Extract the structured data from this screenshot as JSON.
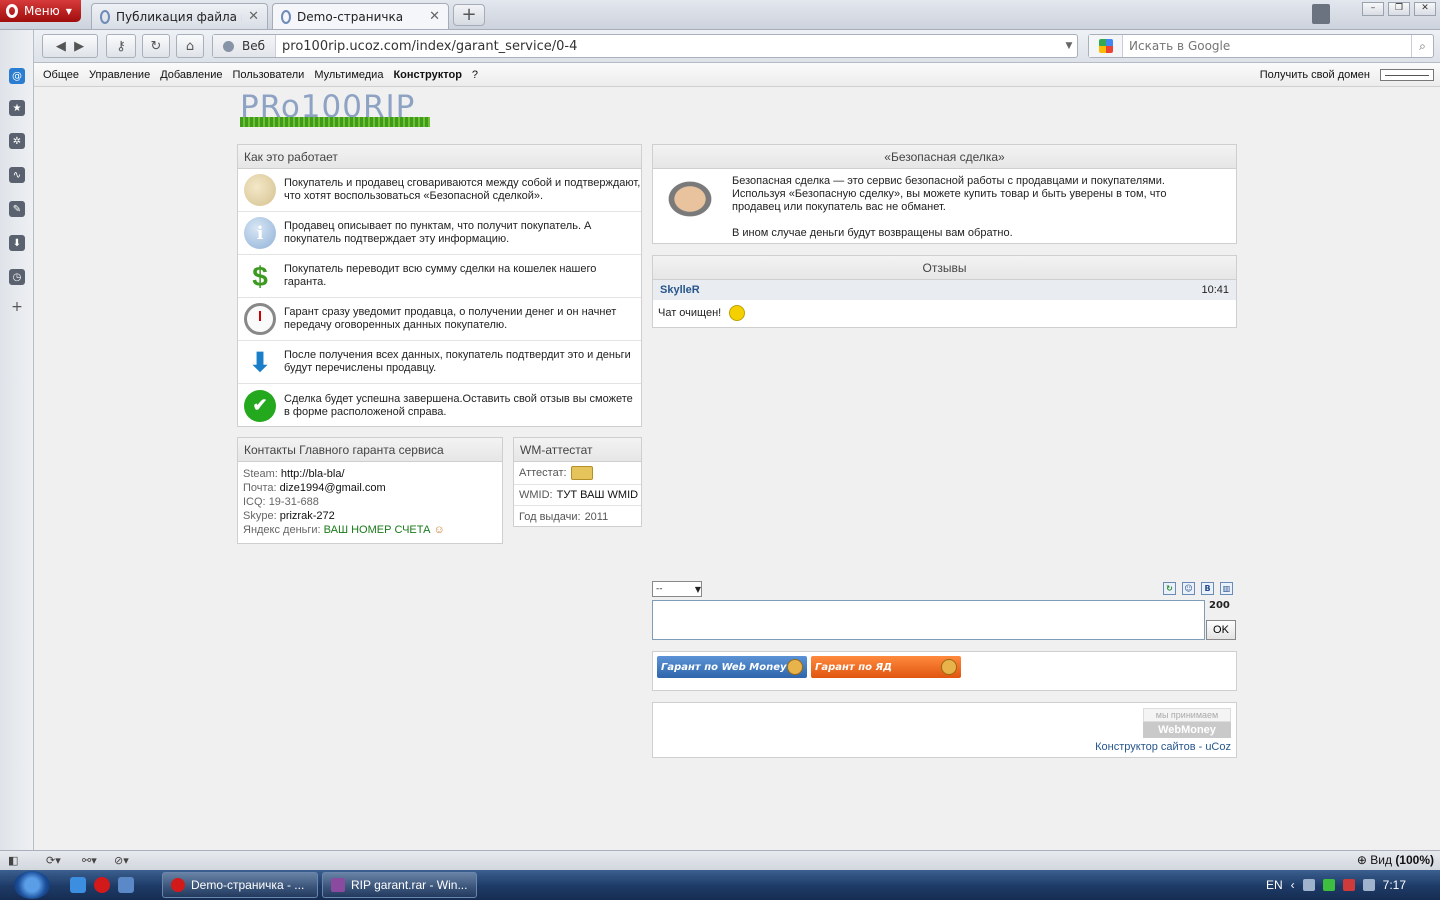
{
  "browser": {
    "menu_label": "Меню",
    "tabs": [
      {
        "label": "Публикация файла н..."
      },
      {
        "label": "Demo-страничка"
      }
    ],
    "web_chip": "Веб",
    "url": "pro100rip.ucoz.com/index/garant_service/0-4",
    "search_placeholder": "Искать в Google",
    "window_buttons": [
      "–",
      "❐",
      "✕"
    ]
  },
  "ucoz_bar": {
    "items": [
      "Общее",
      "Управление",
      "Добавление",
      "Пользователи",
      "Мультимедиа",
      "Конструктор",
      "?"
    ],
    "domain_link": "Получить свой домен"
  },
  "logo_text": "PRo100RIP",
  "how_it_works": {
    "title": "Как это работает",
    "steps": [
      {
        "icon": "chat-bubbles-icon",
        "text": "Покупатель и продавец сговариваются между собой и подтверждают, что хотят воспользоваться «Безопасной сделкой»."
      },
      {
        "icon": "info-icon",
        "text": "Продавец описывает по пунктам, что получит покупатель. А покупатель подтверждает эту информацию."
      },
      {
        "icon": "dollar-icon",
        "text": "Покупатель переводит всю сумму сделки на кошелек нашего гаранта."
      },
      {
        "icon": "stopwatch-icon",
        "text": "Гарант сразу уведомит продавца, о получении денег и он начнет передачу оговоренных данных покупателю."
      },
      {
        "icon": "download-arrow-icon",
        "text": "После получения всех данных, покупатель подтвердит это и деньги будут перечислены продавцу."
      },
      {
        "icon": "checkmark-icon",
        "text": "Сделка будет успешна завершена.Оставить свой отзыв вы сможете в форме расположеной справа."
      }
    ]
  },
  "contacts": {
    "title": "Контакты Главного гаранта сервиса",
    "rows": [
      {
        "key": "Steam:",
        "value": "http://bla-bla/"
      },
      {
        "key": "Почта:",
        "value": "dize1994@gmail.com"
      },
      {
        "key": "ICQ:",
        "value": "19-31-688"
      },
      {
        "key": "Skype:",
        "value": "prizrak-272"
      },
      {
        "key": "Яндекс деньги:",
        "value": "ВАШ НОМЕР СЧЕТА"
      }
    ]
  },
  "wm_attestat": {
    "title": "WM-аттестат",
    "attestat_label": "Аттестат:",
    "wmid_label": "WMID:",
    "wmid_value": "ТУТ ВАШ WMID",
    "year_label": "Год выдачи:",
    "year_value": "2011"
  },
  "safe_deal": {
    "title": "«Безопасная сделка»",
    "text1": "Безопасная сделка — это сервис безопасной работы с продавцами и покупателями. Используя «Безопасную сделку», вы можете купить товар и быть уверены в том, что продавец или покупатель вас не обманет.",
    "text2": "В ином случае деньги будут возвращены вам обратно."
  },
  "reviews": {
    "title": "Отзывы",
    "items": [
      {
        "author": "SkylleR",
        "time": "10:41",
        "message": "Чат очищен!"
      }
    ]
  },
  "chat_form": {
    "select_value": "--",
    "counter": "200",
    "ok_label": "OK",
    "tools": [
      "↻",
      "☺",
      "B",
      "▥"
    ]
  },
  "guarant_buttons": {
    "webmoney": "Гарант по Web Money",
    "yad": "Гарант по ЯД"
  },
  "footer": {
    "wm_accept_top": "мы принимаем",
    "wm_accept_logo": "WebMoney",
    "constructor_link": "Конструктор сайтов - uCoz"
  },
  "statusbar": {
    "zoom_label": "Вид",
    "zoom_value": "(100%)"
  },
  "taskbar": {
    "tasks": [
      "Demo-страничка - ...",
      "RIP garant.rar - Win..."
    ],
    "lang": "EN",
    "clock": "7:17"
  },
  "colors": {
    "accent_red": "#d40000",
    "link_blue": "#27568c",
    "wm_blue": "#3d78c4",
    "yad_orange": "#f26a21"
  }
}
